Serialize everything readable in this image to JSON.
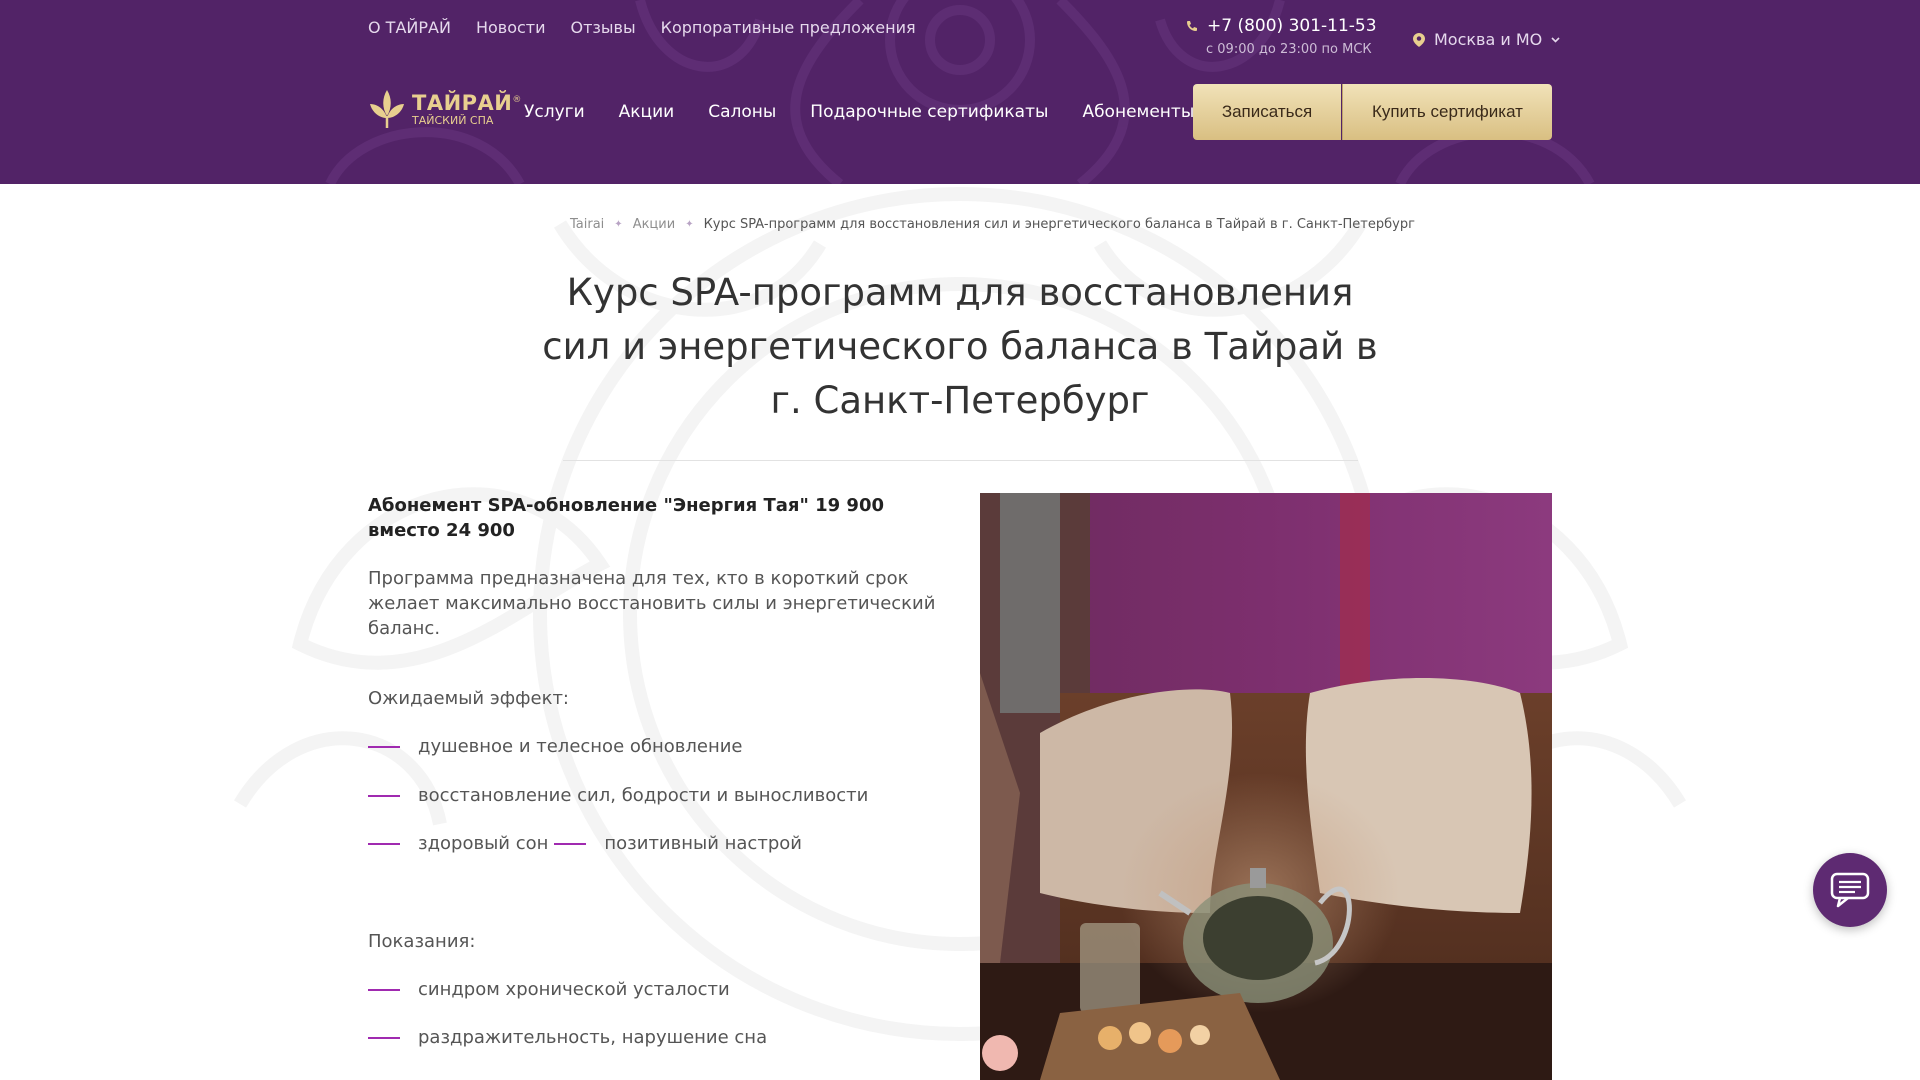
{
  "header": {
    "top_links": [
      "О ТАЙРАЙ",
      "Новости",
      "Отзывы",
      "Корпоративные предложения"
    ],
    "phone": "+7 (800) 301-11-53",
    "phone_hours": "с 09:00 до 23:00 по МСК",
    "city": "Москва и МО",
    "logo": {
      "main": "ТАЙРАЙ",
      "sub": "ТАЙСКИЙ СПА",
      "reg": "®"
    },
    "nav": [
      "Услуги",
      "Акции",
      "Салоны",
      "Подарочные сертификаты",
      "Абонементы"
    ],
    "book_button": "Записаться",
    "cert_button": "Купить сертификат"
  },
  "breadcrumb": {
    "items": [
      "Tairai",
      "Акции"
    ],
    "current": "Курс SPA-программ для восстановления сил и энергетического баланса в Тайрай в г. Санкт-Петербург",
    "separator": "✦"
  },
  "page": {
    "title": "Курс SPA-программ для восстановления сил и энергетического баланса в Тайрай в г. Санкт-Петербург"
  },
  "offer": {
    "title": "Абонемент SPA-обновление \"Энергия Тая\" 19 900 вместо 24 900",
    "description": "Программа предназначена для тех, кто в короткий срок желает максимально восстановить силы и энергетический баланс.",
    "effect_label": "Ожидаемый эффект:",
    "effects": [
      "душевное и телесное обновление",
      "восстановление сил, бодрости и выносливости",
      "здоровый сон",
      "позитивный настрой"
    ],
    "indications_label": "Показания:",
    "indications": [
      "синдром хронической усталости",
      "раздражительность, нарушение сна"
    ]
  },
  "colors": {
    "header_bg": "#522367",
    "accent_gold": "#d9bf82",
    "dash": "#a02ab0",
    "chat_bg": "#5e2a72"
  },
  "icons": {
    "phone": "phone-icon",
    "location": "location-pin-icon",
    "chevron": "chevron-down-icon",
    "logo": "lotus-logo-icon",
    "chat": "chat-icon"
  }
}
